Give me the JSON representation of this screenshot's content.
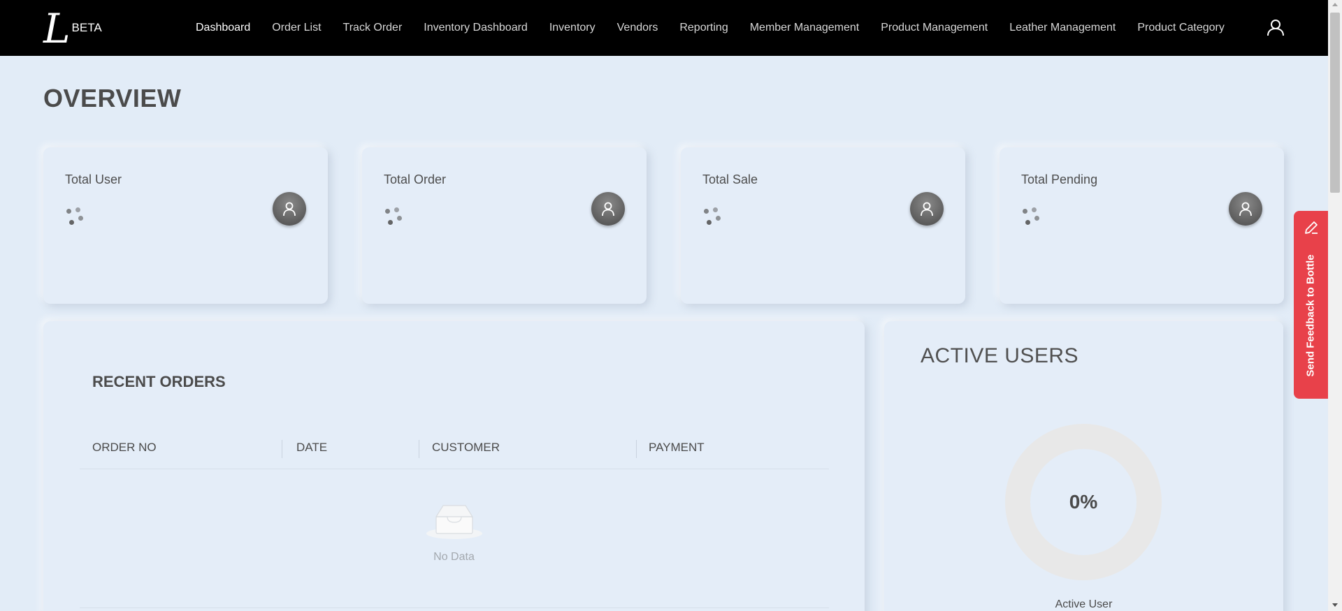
{
  "brand": {
    "logo_letter": "L",
    "badge": "BETA"
  },
  "nav": {
    "items": [
      {
        "label": "Dashboard",
        "active": true
      },
      {
        "label": "Order List"
      },
      {
        "label": "Track Order"
      },
      {
        "label": "Inventory Dashboard"
      },
      {
        "label": "Inventory"
      },
      {
        "label": "Vendors"
      },
      {
        "label": "Reporting"
      },
      {
        "label": "Member Management"
      },
      {
        "label": "Product Management"
      },
      {
        "label": "Leather Management"
      },
      {
        "label": "Product Category"
      }
    ],
    "user_icon": "user-icon"
  },
  "page": {
    "title": "OVERVIEW"
  },
  "stats": [
    {
      "label": "Total User",
      "icon": "user-avatar-icon",
      "loading": true
    },
    {
      "label": "Total Order",
      "icon": "user-avatar-icon",
      "loading": true
    },
    {
      "label": "Total Sale",
      "icon": "user-avatar-icon",
      "loading": true
    },
    {
      "label": "Total Pending",
      "icon": "user-avatar-icon",
      "loading": true
    }
  ],
  "recent_orders": {
    "title": "RECENT ORDERS",
    "columns": [
      "ORDER NO",
      "DATE",
      "CUSTOMER",
      "PAYMENT"
    ],
    "rows": [],
    "empty_text": "No Data"
  },
  "active_users": {
    "title": "ACTIVE USERS",
    "percent_label": "0%",
    "percent_value": 0,
    "caption": "Active User",
    "ring_color": "#e8e8e8"
  },
  "feedback": {
    "label": "Send Feedback to Bottle",
    "icon": "pencil-icon",
    "color": "#e8414a"
  },
  "colors": {
    "navbar": "#000000",
    "background": "#e2ecf7",
    "card": "#e4edf8"
  }
}
